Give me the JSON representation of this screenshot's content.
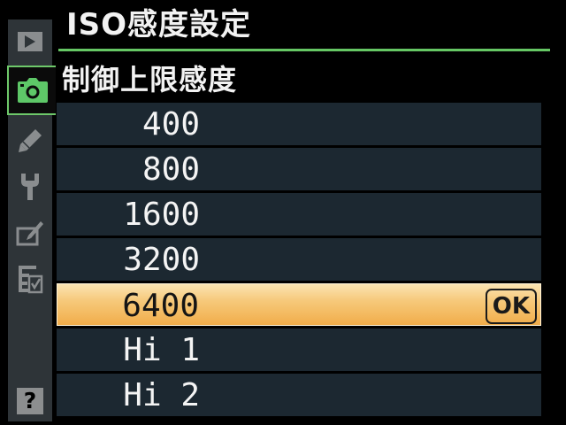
{
  "header": {
    "title": "ISO感度設定",
    "section": "制御上限感度"
  },
  "sidebar": {
    "items": [
      {
        "icon": "playback-icon",
        "active": false
      },
      {
        "icon": "camera-icon",
        "active": true
      },
      {
        "icon": "pencil-icon",
        "active": false
      },
      {
        "icon": "wrench-icon",
        "active": false
      },
      {
        "icon": "retouch-icon",
        "active": false
      },
      {
        "icon": "my-menu-icon",
        "active": false
      }
    ],
    "help_label": "?"
  },
  "options": {
    "items": [
      {
        "label": "400",
        "selected": false
      },
      {
        "label": "800",
        "selected": false
      },
      {
        "label": "1600",
        "selected": false
      },
      {
        "label": "3200",
        "selected": false
      },
      {
        "label": "6400",
        "selected": true
      },
      {
        "label": "Hi 1",
        "selected": false
      },
      {
        "label": "Hi 2",
        "selected": false
      }
    ],
    "ok_label": "OK"
  },
  "colors": {
    "accent_green": "#66c764",
    "row_bg": "#1c2831",
    "selected_bg": "#f6c97b",
    "sidebar_bg": "#2e3438"
  }
}
